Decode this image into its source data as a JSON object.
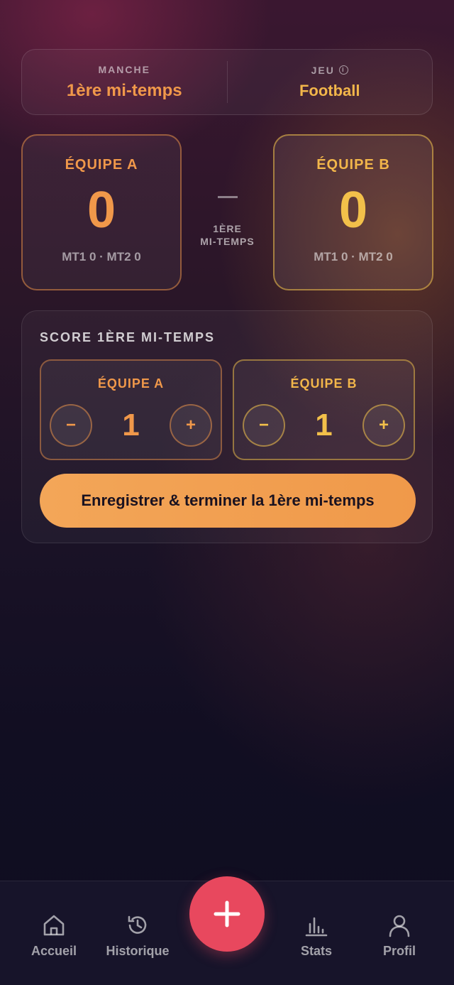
{
  "info": {
    "round_label": "MANCHE",
    "round_value": "1ère mi-temps",
    "game_label": "JEU",
    "game_value": "Football"
  },
  "scoreboard": {
    "team_a": {
      "name": "ÉQUIPE A",
      "score": "0",
      "sub": "MT1 0 · MT2 0"
    },
    "team_b": {
      "name": "ÉQUIPE B",
      "score": "0",
      "sub": "MT1 0 · MT2 0"
    },
    "separator": "–",
    "period_line1": "1ÈRE",
    "period_line2": "MI-TEMPS"
  },
  "score_panel": {
    "title": "SCORE 1ÈRE MI-TEMPS",
    "team_a": {
      "name": "ÉQUIPE A",
      "value": "1",
      "minus": "−",
      "plus": "+"
    },
    "team_b": {
      "name": "ÉQUIPE B",
      "value": "1",
      "minus": "−",
      "plus": "+"
    },
    "save_label": "Enregistrer & terminer la 1ère mi-temps"
  },
  "nav": {
    "home": "Accueil",
    "history": "Historique",
    "stats": "Stats",
    "profile": "Profil"
  },
  "colors": {
    "accent_orange": "#f0984a",
    "accent_yellow": "#f2c04a",
    "fab": "#e8485e"
  }
}
